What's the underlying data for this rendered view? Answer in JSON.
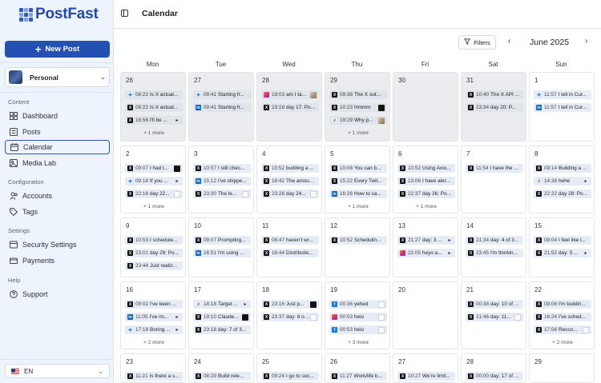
{
  "app": {
    "name": "PostFast"
  },
  "sidebar": {
    "new_post": "New Post",
    "workspace": "Personal",
    "sections": [
      {
        "label": "Content",
        "items": [
          {
            "label": "Dashboard",
            "icon": "dashboard-icon"
          },
          {
            "label": "Posts",
            "icon": "posts-icon"
          },
          {
            "label": "Calendar",
            "icon": "calendar-icon",
            "active": true
          },
          {
            "label": "Media Lab",
            "icon": "media-icon"
          }
        ]
      },
      {
        "label": "Configuration",
        "items": [
          {
            "label": "Accounts",
            "icon": "accounts-icon"
          },
          {
            "label": "Tags",
            "icon": "tag-icon"
          }
        ]
      },
      {
        "label": "Settings",
        "items": [
          {
            "label": "Security Settings",
            "icon": "shield-icon"
          },
          {
            "label": "Payments",
            "icon": "card-icon"
          }
        ]
      },
      {
        "label": "Help",
        "items": [
          {
            "label": "Support",
            "icon": "help-icon"
          }
        ]
      }
    ],
    "language": "EN"
  },
  "header": {
    "title": "Calendar",
    "filters_label": "Filters",
    "month": "June 2025"
  },
  "calendar": {
    "weekdays": [
      "Mon",
      "Tue",
      "Wed",
      "Thu",
      "Fri",
      "Sat",
      "Sun"
    ],
    "weeks": [
      [
        {
          "day": "26",
          "other": true,
          "posts": [
            {
              "time": "08:22",
              "text": "Is X actual...",
              "icon": "bs"
            },
            {
              "time": "08:22",
              "text": "Is X actual...",
              "icon": "x"
            },
            {
              "time": "16:56",
              "text": "I'll be ...",
              "icon": "x",
              "thumb": "arr"
            }
          ],
          "more": "+ 1 more"
        },
        {
          "day": "27",
          "other": true,
          "posts": [
            {
              "time": "09:41",
              "text": "Starting fr...",
              "icon": "bs"
            },
            {
              "time": "09:41",
              "text": "Starting fr...",
              "icon": "li"
            }
          ]
        },
        {
          "day": "28",
          "other": true,
          "posts": [
            {
              "time": "19:03",
              "text": "am I ta...",
              "icon": "ig",
              "thumb": "pic2"
            },
            {
              "time": "23:18",
              "text": "day 17: Po...",
              "icon": "x"
            }
          ]
        },
        {
          "day": "29",
          "other": true,
          "posts": [
            {
              "time": "09:38",
              "text": "The X out...",
              "icon": "x"
            },
            {
              "time": "10:23",
              "text": "Hmmm",
              "icon": "x",
              "thumb": "dark"
            },
            {
              "time": "19:29",
              "text": "Why p...",
              "icon": "tt",
              "thumb": "pic2"
            }
          ],
          "more": "+ 1 more"
        },
        {
          "day": "30",
          "other": true,
          "posts": []
        },
        {
          "day": "31",
          "other": true,
          "posts": [
            {
              "time": "10:40",
              "text": "The X API ...",
              "icon": "x"
            },
            {
              "time": "23:34",
              "text": "day 20: P...",
              "icon": "x"
            }
          ]
        },
        {
          "day": "1",
          "other": false,
          "posts": [
            {
              "time": "11:57",
              "text": "I tell in Cur...",
              "icon": "bs"
            },
            {
              "time": "11:57",
              "text": "I tell in Cur...",
              "icon": "li"
            }
          ]
        }
      ],
      [
        {
          "day": "2",
          "posts": [
            {
              "time": "09:07",
              "text": "I had t...",
              "icon": "x",
              "thumb": "dark"
            },
            {
              "time": "09:18",
              "text": "If you ...",
              "icon": "bs",
              "thumb": "arr"
            },
            {
              "time": "22:16",
              "text": "day 22...",
              "icon": "x",
              "thumb": "light"
            }
          ],
          "more": "+ 1 more"
        },
        {
          "day": "3",
          "posts": [
            {
              "time": "10:57",
              "text": "I still chec...",
              "icon": "x"
            },
            {
              "time": "15:12",
              "text": "I've shippe...",
              "icon": "li"
            },
            {
              "time": "23:30",
              "text": "The le...",
              "icon": "x",
              "thumb": "light"
            }
          ]
        },
        {
          "day": "4",
          "posts": [
            {
              "time": "10:52",
              "text": "building a ...",
              "icon": "x"
            },
            {
              "time": "16:42",
              "text": "The amou...",
              "icon": "x"
            },
            {
              "time": "23:28",
              "text": "day 24...",
              "icon": "x",
              "thumb": "light"
            }
          ]
        },
        {
          "day": "5",
          "posts": [
            {
              "time": "10:08",
              "text": "You can b...",
              "icon": "x"
            },
            {
              "time": "15:22",
              "text": "Every Twit...",
              "icon": "x"
            },
            {
              "time": "16:26",
              "text": "How to sa...",
              "icon": "li"
            }
          ],
          "more": "+ 1 more"
        },
        {
          "day": "6",
          "posts": [
            {
              "time": "10:52",
              "text": "Using Axio...",
              "icon": "x"
            },
            {
              "time": "13:06",
              "text": "I have aler...",
              "icon": "x"
            },
            {
              "time": "22:37",
              "text": "day 26: Po...",
              "icon": "x"
            }
          ],
          "more": "+ 1 more"
        },
        {
          "day": "7",
          "posts": [
            {
              "time": "11:54",
              "text": "I have the ...",
              "icon": "x"
            }
          ]
        },
        {
          "day": "8",
          "posts": [
            {
              "time": "09:14",
              "text": "Building a ...",
              "icon": "x"
            },
            {
              "time": "14:38",
              "text": "hehe",
              "icon": "tt",
              "thumb": "arr"
            },
            {
              "time": "22:22",
              "text": "day 28: Po...",
              "icon": "x"
            }
          ]
        }
      ],
      [
        {
          "day": "9",
          "posts": [
            {
              "time": "10:53",
              "text": "I schedule...",
              "icon": "x"
            },
            {
              "time": "23:01",
              "text": "day 29: Po...",
              "icon": "x"
            },
            {
              "time": "23:44",
              "text": "Just realiz...",
              "icon": "x"
            }
          ]
        },
        {
          "day": "10",
          "posts": [
            {
              "time": "09:07",
              "text": "Prompting...",
              "icon": "x"
            },
            {
              "time": "16:51",
              "text": "I'm using ...",
              "icon": "li"
            }
          ]
        },
        {
          "day": "11",
          "posts": [
            {
              "time": "08:47",
              "text": "haven't wr...",
              "icon": "x"
            },
            {
              "time": "16:44",
              "text": "Distributio...",
              "icon": "x"
            }
          ]
        },
        {
          "day": "12",
          "posts": [
            {
              "time": "10:52",
              "text": "Schedulin...",
              "icon": "x"
            }
          ]
        },
        {
          "day": "13",
          "posts": [
            {
              "time": "21:27",
              "text": "day: 3 ...",
              "icon": "x",
              "thumb": "arr"
            },
            {
              "time": "22:05",
              "text": "heyo a...",
              "icon": "ig",
              "thumb": "arr"
            }
          ]
        },
        {
          "day": "14",
          "posts": [
            {
              "time": "21:34",
              "text": "day: 4 of 3...",
              "icon": "x"
            },
            {
              "time": "23:45",
              "text": "I'm thinkin...",
              "icon": "x"
            }
          ]
        },
        {
          "day": "15",
          "posts": [
            {
              "time": "09:04",
              "text": "I feel like I...",
              "icon": "x"
            },
            {
              "time": "21:52",
              "text": "day: 5 ...",
              "icon": "x",
              "thumb": "arr"
            }
          ]
        }
      ],
      [
        {
          "day": "16",
          "posts": [
            {
              "time": "09:02",
              "text": "I've been ...",
              "icon": "x"
            },
            {
              "time": "11:05",
              "text": "I've im...",
              "icon": "li",
              "thumb": "arr"
            },
            {
              "time": "17:18",
              "text": "Boring ...",
              "icon": "bs",
              "thumb": "arr"
            }
          ],
          "more": "+ 2 more"
        },
        {
          "day": "17",
          "posts": [
            {
              "time": "18:18",
              "text": "Target ...",
              "icon": "tt",
              "thumb": "arr"
            },
            {
              "time": "19:10",
              "text": "Claude...",
              "icon": "x",
              "thumb": "dark"
            },
            {
              "time": "23:18",
              "text": "day: 7 of 3...",
              "icon": "x"
            }
          ]
        },
        {
          "day": "18",
          "posts": [
            {
              "time": "23:16",
              "text": "Just p...",
              "icon": "x",
              "thumb": "dark"
            },
            {
              "time": "23:37",
              "text": "day: 8 of ...",
              "icon": "x",
              "thumb": "light"
            }
          ]
        },
        {
          "day": "19",
          "posts": [
            {
              "time": "00:36",
              "text": "yehed",
              "icon": "fb",
              "thumb": "light"
            },
            {
              "time": "00:53",
              "text": "heio",
              "icon": "ig",
              "thumb": "light"
            },
            {
              "time": "00:53",
              "text": "heio",
              "icon": "fb",
              "thumb": "light"
            }
          ],
          "more": "+ 3 more"
        },
        {
          "day": "20",
          "posts": []
        },
        {
          "day": "21",
          "posts": [
            {
              "time": "00:38",
              "text": "day: 10 of ...",
              "icon": "x"
            },
            {
              "time": "21:46",
              "text": "day: 11...",
              "icon": "x",
              "thumb": "light"
            }
          ]
        },
        {
          "day": "22",
          "posts": [
            {
              "time": "09:08",
              "text": "I'm buildin...",
              "icon": "x"
            },
            {
              "time": "16:24",
              "text": "I've sched...",
              "icon": "x"
            },
            {
              "time": "17:56",
              "text": "Recco...",
              "icon": "x",
              "thumb": "light"
            }
          ],
          "more": "+ 2 more"
        }
      ],
      [
        {
          "day": "23",
          "posts": [
            {
              "time": "11:21",
              "text": "Is there a s...",
              "icon": "x"
            }
          ]
        },
        {
          "day": "24",
          "posts": [
            {
              "time": "08:29",
              "text": "Build rele...",
              "icon": "x"
            }
          ]
        },
        {
          "day": "25",
          "posts": [
            {
              "time": "09:24",
              "text": "I go to suc...",
              "icon": "x"
            }
          ]
        },
        {
          "day": "26",
          "posts": [
            {
              "time": "11:27",
              "text": "Work/life b...",
              "icon": "x"
            }
          ]
        },
        {
          "day": "27",
          "posts": [
            {
              "time": "10:27",
              "text": "We're limit...",
              "icon": "x"
            }
          ]
        },
        {
          "day": "28",
          "posts": [
            {
              "time": "00:00",
              "text": "day: 17 of ...",
              "icon": "x"
            }
          ]
        },
        {
          "day": "29",
          "posts": []
        }
      ]
    ]
  }
}
